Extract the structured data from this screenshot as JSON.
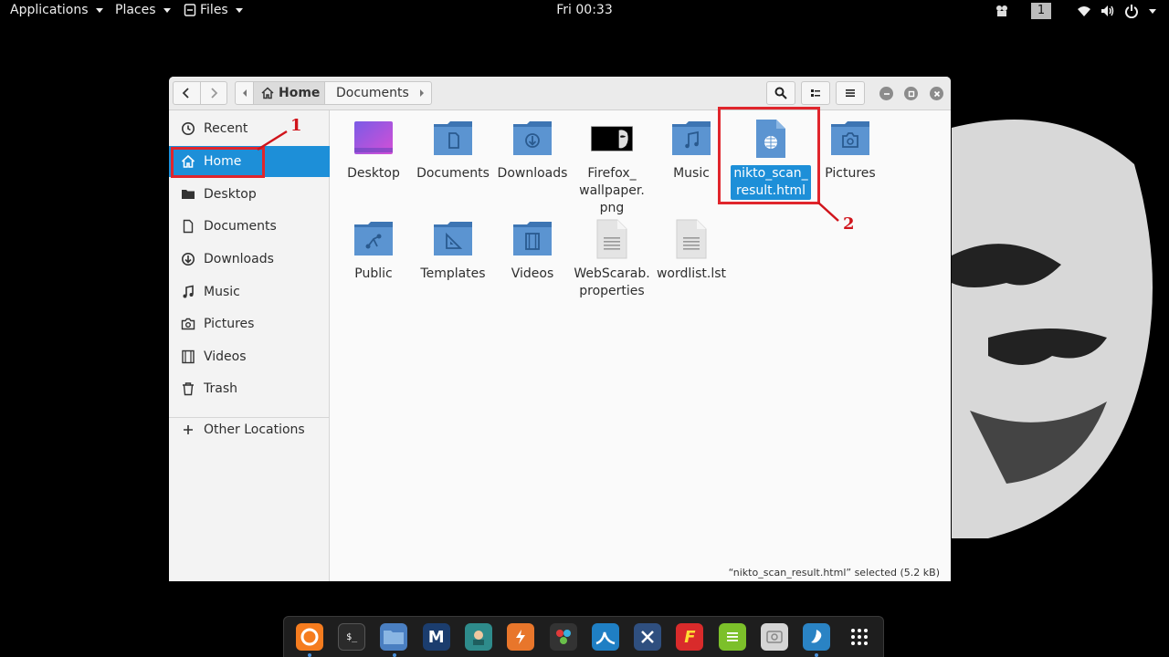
{
  "topbar": {
    "applications": "Applications",
    "places": "Places",
    "files": "Files",
    "clock": "Fri 00:33",
    "workspace": "1"
  },
  "window": {
    "path_home": "Home",
    "path_documents": "Documents"
  },
  "sidebar": {
    "items": [
      {
        "label": "Recent",
        "icon": "clock-icon"
      },
      {
        "label": "Home",
        "icon": "home-icon"
      },
      {
        "label": "Desktop",
        "icon": "folder-icon"
      },
      {
        "label": "Documents",
        "icon": "document-icon"
      },
      {
        "label": "Downloads",
        "icon": "download-icon"
      },
      {
        "label": "Music",
        "icon": "music-icon"
      },
      {
        "label": "Pictures",
        "icon": "camera-icon"
      },
      {
        "label": "Videos",
        "icon": "film-icon"
      },
      {
        "label": "Trash",
        "icon": "trash-icon"
      }
    ],
    "other_locations": "Other Locations"
  },
  "files": [
    {
      "label": "Desktop",
      "icon": "desktop-folder-icon"
    },
    {
      "label": "Documents",
      "icon": "documents-folder-icon"
    },
    {
      "label": "Downloads",
      "icon": "downloads-folder-icon"
    },
    {
      "label": "Firefox_\nwallpaper.\npng",
      "icon": "image-thumbnail-icon"
    },
    {
      "label": "Music",
      "icon": "music-folder-icon"
    },
    {
      "label": "nikto_scan_\nresult.html",
      "icon": "html-file-icon"
    },
    {
      "label": "Pictures",
      "icon": "pictures-folder-icon"
    },
    {
      "label": "Public",
      "icon": "public-folder-icon"
    },
    {
      "label": "Templates",
      "icon": "templates-folder-icon"
    },
    {
      "label": "Videos",
      "icon": "videos-folder-icon"
    },
    {
      "label": "WebScarab.\nproperties",
      "icon": "text-file-icon"
    },
    {
      "label": "wordlist.lst",
      "icon": "text-file-icon"
    }
  ],
  "status": "“nikto_scan_result.html” selected  (5.2 kB)",
  "annotations": [
    "1",
    "2"
  ],
  "dock": [
    {
      "icon": "firefox-icon",
      "color": "#f57c1f"
    },
    {
      "icon": "terminal-icon",
      "color": "#2b2b2b"
    },
    {
      "icon": "files-icon",
      "color": "#4a7fc1"
    },
    {
      "icon": "metasploit-icon",
      "color": "#1b3d6e"
    },
    {
      "icon": "armitage-icon",
      "color": "#2e8b8b"
    },
    {
      "icon": "burpsuite-icon",
      "color": "#e8762b"
    },
    {
      "icon": "maltego-icon",
      "color": "#333333"
    },
    {
      "icon": "wireshark-icon",
      "color": "#1f7fc4"
    },
    {
      "icon": "beef-icon",
      "color": "#2f4f7f"
    },
    {
      "icon": "faraday-icon",
      "color": "#d92b2b"
    },
    {
      "icon": "notes-icon",
      "color": "#7cc02a"
    },
    {
      "icon": "screenshot-icon",
      "color": "#d5d5d5"
    },
    {
      "icon": "kali-icon",
      "color": "#2a83c4"
    },
    {
      "icon": "app-grid-icon",
      "color": "#1e1e1e"
    }
  ]
}
